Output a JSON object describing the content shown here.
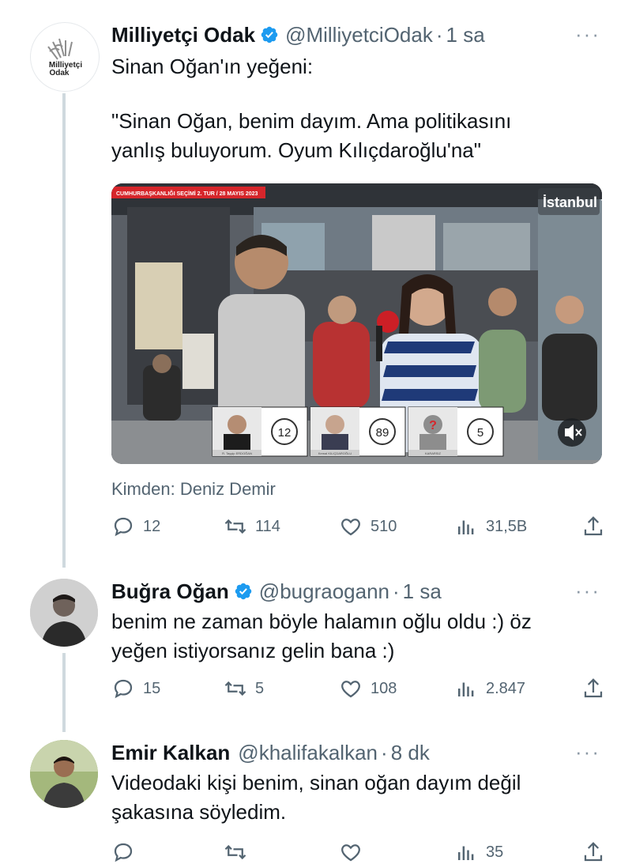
{
  "tweets": [
    {
      "name": "Milliyetçi Odak",
      "handle": "@MilliyetciOdak",
      "time": "1 sa",
      "text_lines": [
        "Sinan Oğan'ın yeğeni:",
        "",
        "\"Sinan Oğan, benim dayım. Ama politikasını",
        "yanlış buluyorum. Oyum Kılıçdaroğlu'na\""
      ],
      "from": "Kimden: Deniz Demir",
      "replies": "12",
      "retweets": "114",
      "likes": "510",
      "views": "31,5B"
    },
    {
      "name": "Buğra Oğan",
      "handle": "@bugraogann",
      "time": "1 sa",
      "text_lines": [
        "benim ne zaman böyle halamın oğlu oldu :) öz",
        "yeğen istiyorsanız gelin bana :)"
      ],
      "replies": "15",
      "retweets": "5",
      "likes": "108",
      "views": "2.847"
    },
    {
      "name": "Emir Kalkan",
      "handle": "@khalifakalkan",
      "time": "8 dk",
      "text_lines": [
        "Videodaki kişi benim, sinan oğan dayım değil",
        "şakasına söyledim."
      ],
      "replies": "",
      "retweets": "",
      "likes": "",
      "views": "35"
    }
  ],
  "media": {
    "banner": "CUMHURBAŞKANLIĞI SEÇİMİ 2. TUR / 28 MAYIS 2023",
    "channel": "İstanbul tv",
    "poll": [
      "12",
      "89",
      "5"
    ],
    "candidates": [
      "R. Tayyip ERDOĞAN",
      "Kemal KILIÇDAROĞLU",
      "KARARSIZ"
    ]
  },
  "logo_text": "Milliyetçi Odak",
  "colors": {
    "verified": "#1d9bf0",
    "muted": "#536471",
    "thread": "#cfd9de",
    "banner_red": "#d6262b"
  },
  "icons": [
    "reply-icon",
    "retweet-icon",
    "like-icon",
    "views-icon",
    "share-icon",
    "verified-badge-icon",
    "more-icon",
    "mute-icon"
  ]
}
